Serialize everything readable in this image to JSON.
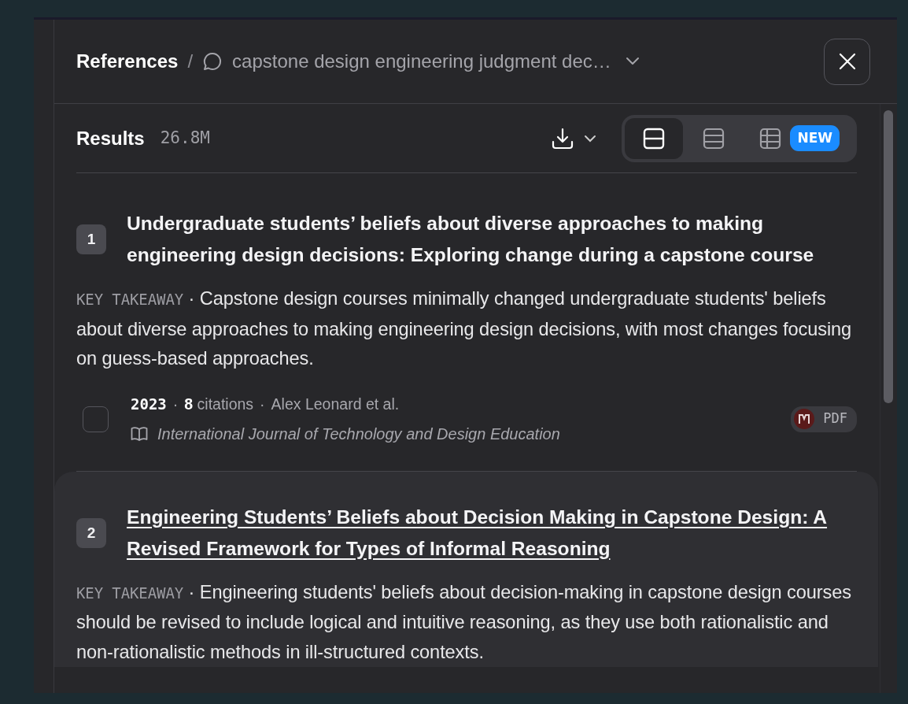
{
  "header": {
    "title": "References",
    "separator": "/",
    "query": "capstone design engineering judgment dec…"
  },
  "results": {
    "label": "Results",
    "count": "26.8M",
    "views": [
      {
        "kind": "card",
        "selected": true
      },
      {
        "kind": "list",
        "selected": false
      },
      {
        "kind": "table",
        "selected": false,
        "badge": "NEW"
      }
    ]
  },
  "papers": [
    {
      "number": "1",
      "title": "Undergraduate students’ beliefs about diverse approaches to making engineering design decisions: Exploring change during a capstone course",
      "hovered": false,
      "takeaway_label": "KEY TAKEAWAY",
      "separator": "·",
      "takeaway": "Capstone design courses minimally changed undergraduate students' beliefs about diverse approaches to making engineering design decisions, with most changes focusing on guess-based approaches.",
      "year": "2023",
      "meta_separator": "·",
      "citations": "8",
      "citations_label": "citations",
      "authors": "Alex Leonard et al.",
      "journal": "International Journal of Technology and Design Education",
      "pdf_label": "PDF",
      "checked": false
    },
    {
      "number": "2",
      "title": "Engineering Students’ Beliefs about Decision Making in Capstone Design: A Revised Framework for Types of Informal Reasoning",
      "hovered": true,
      "takeaway_label": "KEY TAKEAWAY",
      "separator": "·",
      "takeaway": "Engineering students' beliefs about decision-making in capstone design courses should be revised to include logical and intuitive reasoning, as they use both rationalistic and non-rationalistic methods in ill-structured contexts."
    }
  ]
}
